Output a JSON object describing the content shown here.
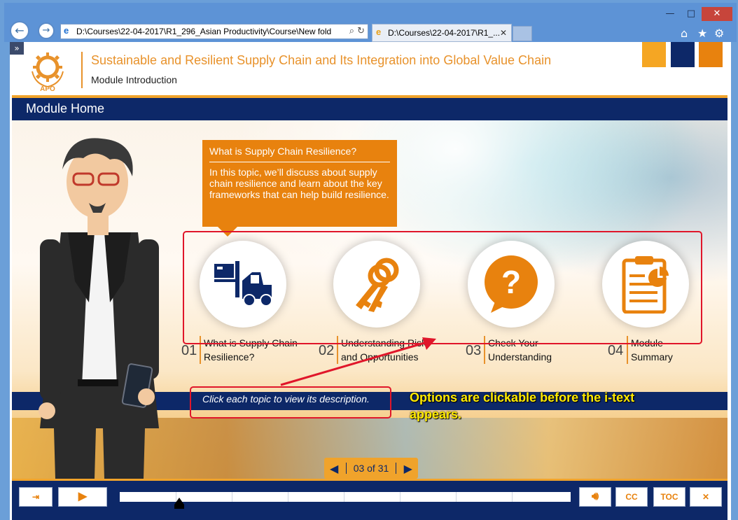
{
  "browser": {
    "address": "D:\\Courses\\22-04-2017\\R1_296_Asian Productivity\\Course\\New fold",
    "tab_label": "D:\\Courses\\22-04-2017\\R1_...",
    "window_controls": [
      "minimize-icon",
      "maximize-icon",
      "close-icon"
    ]
  },
  "header": {
    "course_title": "Sustainable and Resilient Supply Chain and Its Integration into Global Value Chain",
    "module_label": "Module Introduction",
    "logo_text": "APO",
    "brand_colors": [
      "#f0a32b",
      "#0d2868",
      "#e8820e"
    ]
  },
  "titlebar": {
    "label": "Module Home"
  },
  "tooltip": {
    "title": "What is Supply Chain Resilience?",
    "body": "In this topic, we’ll discuss about supply chain resilience and learn about the key frameworks that can help build resilience."
  },
  "topics": [
    {
      "num": "01",
      "line1": "What is Supply Chain",
      "line2": "Resilience?",
      "icon": "forklift-icon"
    },
    {
      "num": "02",
      "line1": "Understanding Risk",
      "line2": "and Opportunities",
      "icon": "keys-icon"
    },
    {
      "num": "03",
      "line1": "Check Your",
      "line2": "Understanding",
      "icon": "question-icon"
    },
    {
      "num": "04",
      "line1": "Module",
      "line2": "Summary",
      "icon": "clipboard-chart-icon"
    }
  ],
  "hint": "Click each topic to view its description.",
  "annotation": {
    "line1": "Options are clickable before the i-text",
    "line2": "appears."
  },
  "pager": {
    "text": "03 of 31",
    "current": 3,
    "total": 31
  },
  "controls": {
    "exit": "exit-icon",
    "play": "play-icon",
    "audio": "speaker-icon",
    "cc": "CC",
    "toc": "TOC",
    "close": "✕"
  }
}
